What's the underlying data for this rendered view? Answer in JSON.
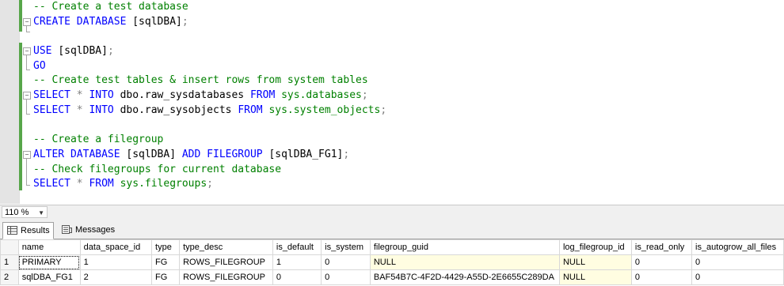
{
  "editor": {
    "lines": [
      [
        {
          "t": "-- Create a test database",
          "c": "cm"
        }
      ],
      [
        {
          "t": "CREATE DATABASE ",
          "c": "kw"
        },
        {
          "t": "[sqlDBA]",
          "c": "pl"
        },
        {
          "t": ";",
          "c": "gr"
        }
      ],
      [],
      [
        {
          "t": "USE ",
          "c": "kw"
        },
        {
          "t": "[sqlDBA]",
          "c": "pl"
        },
        {
          "t": ";",
          "c": "gr"
        }
      ],
      [
        {
          "t": "GO",
          "c": "kw"
        }
      ],
      [
        {
          "t": "-- Create test tables & insert rows from system tables",
          "c": "cm"
        }
      ],
      [
        {
          "t": "SELECT ",
          "c": "kw"
        },
        {
          "t": "* ",
          "c": "gr"
        },
        {
          "t": "INTO ",
          "c": "kw"
        },
        {
          "t": "dbo.raw_sysdatabases ",
          "c": "pl"
        },
        {
          "t": "FROM ",
          "c": "kw"
        },
        {
          "t": "sys.databases",
          "c": "sy"
        },
        {
          "t": ";",
          "c": "gr"
        }
      ],
      [
        {
          "t": "SELECT ",
          "c": "kw"
        },
        {
          "t": "* ",
          "c": "gr"
        },
        {
          "t": "INTO ",
          "c": "kw"
        },
        {
          "t": "dbo.raw_sysobjects ",
          "c": "pl"
        },
        {
          "t": "FROM ",
          "c": "kw"
        },
        {
          "t": "sys.system_objects",
          "c": "sy"
        },
        {
          "t": ";",
          "c": "gr"
        }
      ],
      [],
      [
        {
          "t": "-- Create a filegroup",
          "c": "cm"
        }
      ],
      [
        {
          "t": "ALTER DATABASE ",
          "c": "kw"
        },
        {
          "t": "[sqlDBA] ",
          "c": "pl"
        },
        {
          "t": "ADD FILEGROUP ",
          "c": "kw"
        },
        {
          "t": "[sqlDBA_FG1]",
          "c": "pl"
        },
        {
          "t": ";",
          "c": "gr"
        }
      ],
      [
        {
          "t": "-- Check filegroups for current database",
          "c": "cm"
        }
      ],
      [
        {
          "t": "SELECT ",
          "c": "kw"
        },
        {
          "t": "* ",
          "c": "gr"
        },
        {
          "t": "FROM ",
          "c": "kw"
        },
        {
          "t": "sys.filegroups",
          "c": "sy"
        },
        {
          "t": ";",
          "c": "gr"
        }
      ]
    ]
  },
  "zoom": {
    "value": "110 %"
  },
  "tabs": {
    "results": "Results",
    "messages": "Messages"
  },
  "grid": {
    "columns": [
      "name",
      "data_space_id",
      "type",
      "type_desc",
      "is_default",
      "is_system",
      "filegroup_guid",
      "log_filegroup_id",
      "is_read_only",
      "is_autogrow_all_files"
    ],
    "rows": [
      {
        "n": "1",
        "cells": [
          "PRIMARY",
          "1",
          "FG",
          "ROWS_FILEGROUP",
          "1",
          "0",
          "NULL",
          "NULL",
          "0",
          "0"
        ]
      },
      {
        "n": "2",
        "cells": [
          "sqlDBA_FG1",
          "2",
          "FG",
          "ROWS_FILEGROUP",
          "0",
          "0",
          "BAF54B7C-4F2D-4429-A55D-2E6655C289DA",
          "NULL",
          "0",
          "0"
        ]
      }
    ]
  },
  "colors": {
    "keyword": "#0000ff",
    "comment": "#008000",
    "system_object": "#008000",
    "null_cell": "#fffde1"
  }
}
